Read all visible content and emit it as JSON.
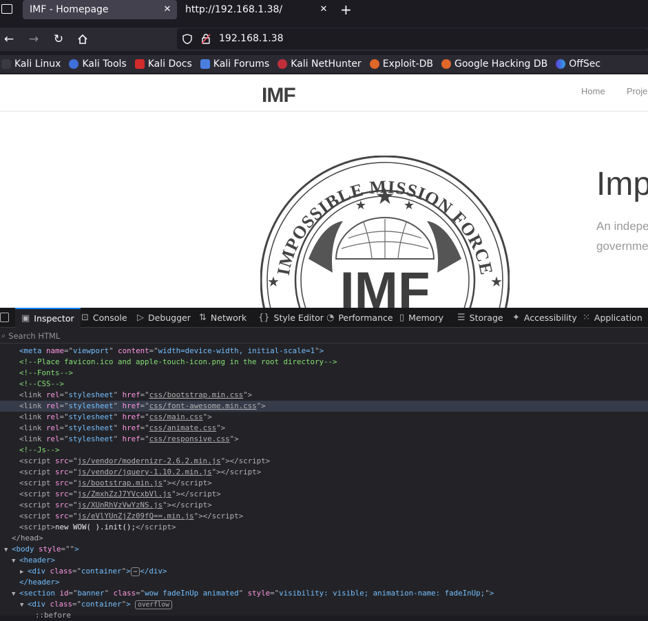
{
  "browser": {
    "tabs": [
      {
        "title": "IMF - Homepage",
        "active": true
      },
      {
        "title": "http://192.168.1.38/",
        "active": false
      }
    ],
    "url": "192.168.1.38",
    "bookmarks": [
      "Kali Linux",
      "Kali Tools",
      "Kali Docs",
      "Kali Forums",
      "Kali NetHunter",
      "Exploit-DB",
      "Google Hacking DB",
      "OffSec"
    ]
  },
  "site": {
    "logo": "IMF",
    "nav": [
      "Home",
      "Proje"
    ],
    "seal_text_top": "IMPOSSIBLE MISSION FORCE",
    "seal_text_center": "IMF",
    "hero_title": "Imp",
    "hero_sub_1": "An indepe",
    "hero_sub_2": "governme"
  },
  "devtools": {
    "tabs": [
      "Inspector",
      "Console",
      "Debugger",
      "Network",
      "Style Editor",
      "Performance",
      "Memory",
      "Storage",
      "Accessibility",
      "Application"
    ],
    "search_placeholder": "Search HTML",
    "lines": {
      "l1": {
        "pre": "<meta ",
        "n1": "name",
        "v1": "viewport",
        "n2": "content",
        "v2": "width=device-width, initial-scale=1",
        "post": ">"
      },
      "l2": "<!--Place favicon.ico and apple-touch-icon.png in the root directory-->",
      "l3": "<!--Fonts-->",
      "l4": "<!--CSS-->",
      "css": [
        "css/bootstrap.min.css",
        "css/font-awesome.min.css",
        "css/main.css",
        "css/animate.css",
        "css/responsive.css"
      ],
      "l10": "<!--Js-->",
      "js": [
        "js/vendor/modernizr-2.6.2.min.js",
        "js/vendor/jquery-1.10.2.min.js",
        "js/bootstrap.min.js",
        "js/ZmxhZzJ7YVcxbVl.js",
        "js/XUnRhVzVwYzNS.js",
        "js/eVlYUnZjZz09fQ==.min.js"
      ],
      "inline_script": "new WOW( ).init();",
      "body_style": "",
      "div_class": "container",
      "section_id": "banner",
      "section_class": "wow fadeInUp animated",
      "section_style": "visibility: visible; animation-name: fadeInUp;",
      "overflow_badge": "overflow",
      "before": "::before"
    }
  }
}
